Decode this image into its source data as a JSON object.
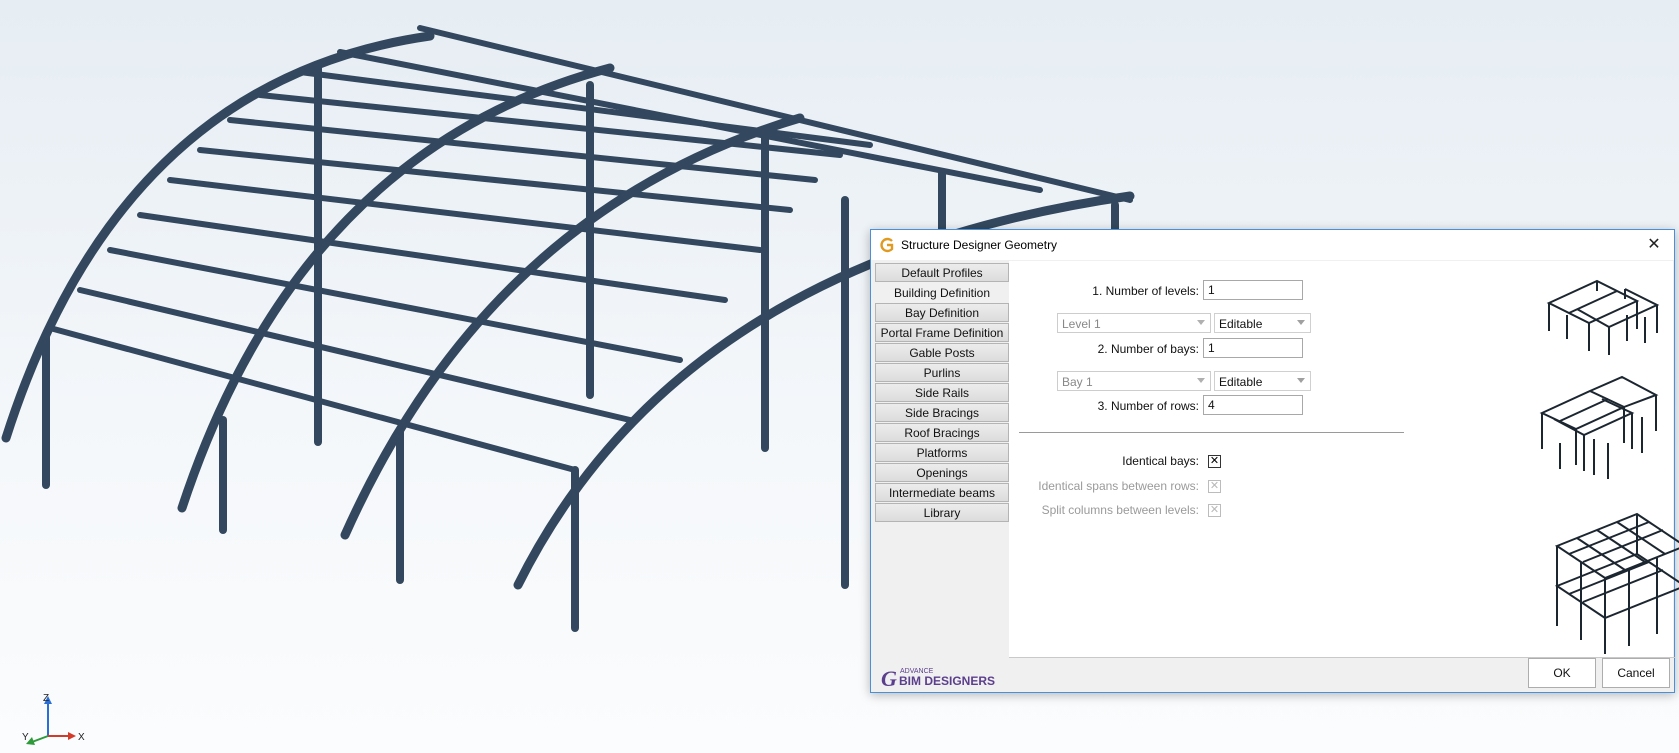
{
  "dialog": {
    "title": "Structure Designer Geometry",
    "close_glyph": "✕",
    "nav": [
      {
        "label": "Default Profiles",
        "active": false
      },
      {
        "label": "Building Definition",
        "active": true
      },
      {
        "label": "Bay Definition",
        "active": false
      },
      {
        "label": "Portal Frame Definition",
        "active": false
      },
      {
        "label": "Gable Posts",
        "active": false
      },
      {
        "label": "Purlins",
        "active": false
      },
      {
        "label": "Side Rails",
        "active": false
      },
      {
        "label": "Side Bracings",
        "active": false
      },
      {
        "label": "Roof Bracings",
        "active": false
      },
      {
        "label": "Platforms",
        "active": false
      },
      {
        "label": "Openings",
        "active": false
      },
      {
        "label": "Intermediate beams",
        "active": false
      },
      {
        "label": "Library",
        "active": false
      }
    ],
    "levels": {
      "label": "1.  Number of levels:",
      "value": "1"
    },
    "level_combo": {
      "value": "Level 1"
    },
    "level_mode": {
      "value": "Editable"
    },
    "bays": {
      "label": "2.  Number of bays:",
      "value": "1"
    },
    "bay_combo": {
      "value": "Bay 1"
    },
    "bay_mode": {
      "value": "Editable"
    },
    "rows": {
      "label": "3.  Number of rows:",
      "value": "4"
    },
    "identical_bays": {
      "label": "Identical bays:",
      "checked": true,
      "glyph": "✕"
    },
    "identical_spans": {
      "label": "Identical spans between rows:",
      "checked": true,
      "glyph": "✕"
    },
    "split_columns": {
      "label": "Split columns between levels:",
      "checked": true,
      "glyph": "✕"
    },
    "ok_label": "OK",
    "cancel_label": "Cancel",
    "logo": {
      "small": "ADVANCE",
      "main": "BIM DESIGNERS",
      "mark": "G"
    }
  },
  "axes": {
    "x": "X",
    "y": "Y",
    "z": "Z"
  },
  "colors": {
    "steel": "#33485e",
    "accent": "#4a90d9",
    "logo": "#5b3f8c"
  }
}
